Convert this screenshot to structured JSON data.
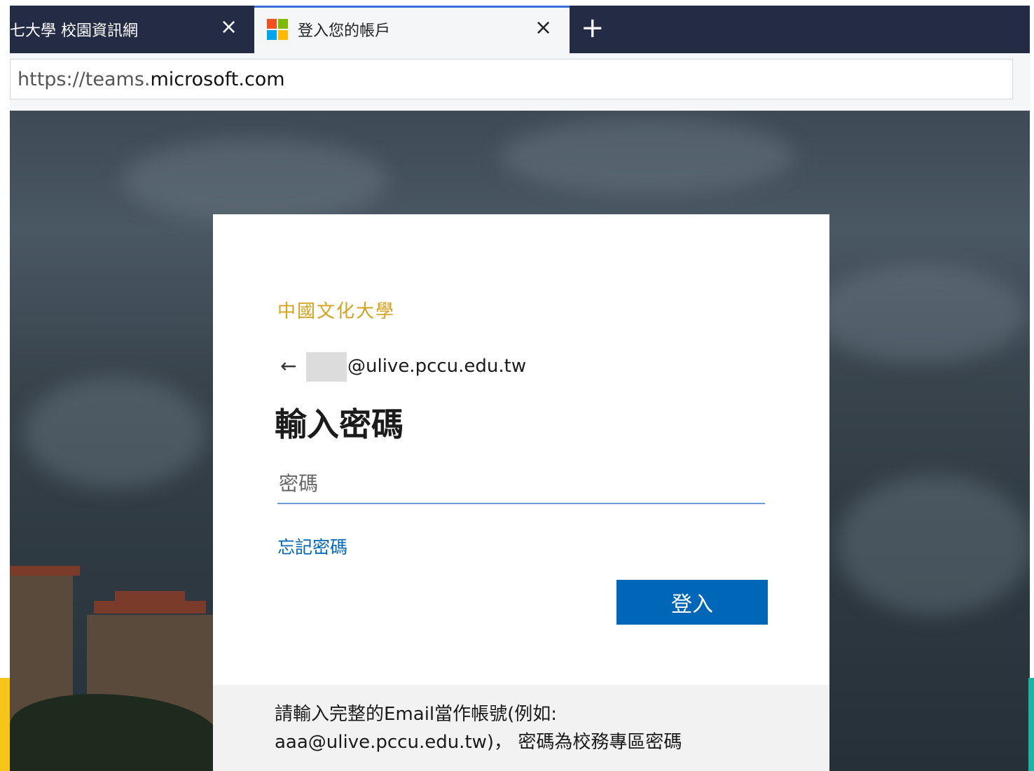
{
  "browser": {
    "tabs": [
      {
        "title": "七大學 校園資訊網",
        "close": "×",
        "active": false
      },
      {
        "title": "登入您的帳戶",
        "close": "×",
        "active": true
      }
    ],
    "new_tab": "+",
    "url_prefix": "https://teams.",
    "url_domain": "microsoft.com"
  },
  "signin": {
    "logo_text": "中國文化大學",
    "back_icon": "←",
    "email": "@ulive.pccu.edu.tw",
    "heading": "輸入密碼",
    "password_placeholder": "密碼",
    "forgot_password": "忘記密碼",
    "submit": "登入",
    "footer_lines": [
      "請輸入完整的Email當作帳號(例如:",
      "aaa@ulive.pccu.edu.tw)， 密碼為校務專區密碼"
    ]
  },
  "colors": {
    "accent": "#0067b8",
    "tabbar": "#232b45",
    "logo_gold": "#d4a21c"
  },
  "icons": [
    "microsoft-logo-icon",
    "close-icon",
    "plus-icon",
    "back-arrow-icon"
  ]
}
